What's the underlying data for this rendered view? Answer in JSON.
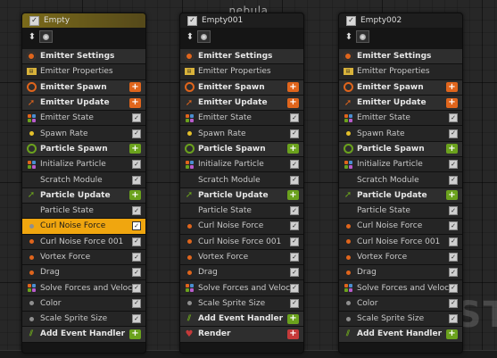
{
  "system": {
    "title": "nebula",
    "watermark": "SYSTE"
  },
  "colors": {
    "spawn": "#e0651c",
    "particle": "#6ba21d",
    "selection": "#f0a60f",
    "render": "#c53a3a"
  },
  "emitters": [
    {
      "name": "Empty",
      "selected": true,
      "rows": [
        {
          "label": "Emitter Settings",
          "kind": "section",
          "icon": "settings-icon"
        },
        {
          "label": "Emitter Properties",
          "kind": "module",
          "icon": "properties-icon"
        },
        {
          "label": "Emitter Spawn",
          "kind": "section",
          "icon": "spawn-ring-icon",
          "button": "+",
          "btn_color": "orange"
        },
        {
          "label": "Emitter Update",
          "kind": "section",
          "icon": "update-arrow-icon",
          "button": "+",
          "btn_color": "orange"
        },
        {
          "label": "Emitter State",
          "kind": "module",
          "icon": "multi-dot-icon",
          "check": "✓"
        },
        {
          "label": "Spawn Rate",
          "kind": "module",
          "icon": "dot-yellow-icon",
          "check": "✓"
        },
        {
          "label": "Particle Spawn",
          "kind": "section",
          "icon": "particle-ring-icon",
          "button": "+",
          "btn_color": "green"
        },
        {
          "label": "Initialize Particle",
          "kind": "module",
          "icon": "multi-dot-icon",
          "check": "✓"
        },
        {
          "label": "Scratch Module",
          "kind": "module",
          "icon": "none",
          "check": "✓"
        },
        {
          "label": "Particle Update",
          "kind": "section",
          "icon": "particle-arrow-icon",
          "button": "+",
          "btn_color": "green"
        },
        {
          "label": "Particle State",
          "kind": "module",
          "icon": "none",
          "check": "✓"
        },
        {
          "label": "Curl Noise Force",
          "kind": "highlight",
          "icon": "dot-gray-icon",
          "check": "✓"
        },
        {
          "label": "Curl Noise Force 001",
          "kind": "module",
          "icon": "dot-orange-icon",
          "check": "✓"
        },
        {
          "label": "Vortex Force",
          "kind": "module",
          "icon": "dot-orange-icon",
          "check": "✓"
        },
        {
          "label": "Drag",
          "kind": "module",
          "icon": "dot-orange-icon",
          "check": "✓"
        },
        {
          "label": "Solve Forces and Velocity",
          "kind": "module",
          "icon": "multi-dot-icon",
          "check": "✓"
        },
        {
          "label": "Color",
          "kind": "module",
          "icon": "dot-gray-icon",
          "check": "✓"
        },
        {
          "label": "Scale Sprite Size",
          "kind": "module",
          "icon": "dot-gray-icon",
          "check": "✓"
        },
        {
          "label": "Add Event Handler",
          "kind": "section",
          "icon": "event-handler-icon",
          "button": "+",
          "btn_color": "green"
        }
      ]
    },
    {
      "name": "Empty001",
      "selected": false,
      "rows": [
        {
          "label": "Emitter Settings",
          "kind": "section",
          "icon": "settings-icon"
        },
        {
          "label": "Emitter Properties",
          "kind": "module",
          "icon": "properties-icon"
        },
        {
          "label": "Emitter Spawn",
          "kind": "section",
          "icon": "spawn-ring-icon",
          "button": "+",
          "btn_color": "orange"
        },
        {
          "label": "Emitter Update",
          "kind": "section",
          "icon": "update-arrow-icon",
          "button": "+",
          "btn_color": "orange"
        },
        {
          "label": "Emitter State",
          "kind": "module",
          "icon": "multi-dot-icon",
          "check": "✓"
        },
        {
          "label": "Spawn Rate",
          "kind": "module",
          "icon": "dot-yellow-icon",
          "check": "✓"
        },
        {
          "label": "Particle Spawn",
          "kind": "section",
          "icon": "particle-ring-icon",
          "button": "+",
          "btn_color": "green"
        },
        {
          "label": "Initialize Particle",
          "kind": "module",
          "icon": "multi-dot-icon",
          "check": "✓"
        },
        {
          "label": "Scratch Module",
          "kind": "module",
          "icon": "none",
          "check": "✓"
        },
        {
          "label": "Particle Update",
          "kind": "section",
          "icon": "particle-arrow-icon",
          "button": "+",
          "btn_color": "green"
        },
        {
          "label": "Particle State",
          "kind": "module",
          "icon": "none",
          "check": "✓"
        },
        {
          "label": "Curl Noise Force",
          "kind": "module",
          "icon": "dot-orange-icon",
          "check": "✓"
        },
        {
          "label": "Curl Noise Force 001",
          "kind": "module",
          "icon": "dot-orange-icon",
          "check": "✓"
        },
        {
          "label": "Vortex Force",
          "kind": "module",
          "icon": "dot-orange-icon",
          "check": "✓"
        },
        {
          "label": "Drag",
          "kind": "module",
          "icon": "dot-orange-icon",
          "check": "✓"
        },
        {
          "label": "Solve Forces and Velocity",
          "kind": "module",
          "icon": "multi-dot-icon",
          "check": "✓"
        },
        {
          "label": "Scale Sprite Size",
          "kind": "module",
          "icon": "dot-gray-icon",
          "check": "✓"
        },
        {
          "label": "Add Event Handler",
          "kind": "section",
          "icon": "event-handler-icon",
          "button": "+",
          "btn_color": "green"
        },
        {
          "label": "Render",
          "kind": "section",
          "icon": "render-icon",
          "button": "+",
          "btn_color": "red"
        }
      ]
    },
    {
      "name": "Empty002",
      "selected": false,
      "rows": [
        {
          "label": "Emitter Settings",
          "kind": "section",
          "icon": "settings-icon"
        },
        {
          "label": "Emitter Properties",
          "kind": "module",
          "icon": "properties-icon"
        },
        {
          "label": "Emitter Spawn",
          "kind": "section",
          "icon": "spawn-ring-icon",
          "button": "+",
          "btn_color": "orange"
        },
        {
          "label": "Emitter Update",
          "kind": "section",
          "icon": "update-arrow-icon",
          "button": "+",
          "btn_color": "orange"
        },
        {
          "label": "Emitter State",
          "kind": "module",
          "icon": "multi-dot-icon",
          "check": "✓"
        },
        {
          "label": "Spawn Rate",
          "kind": "module",
          "icon": "dot-yellow-icon",
          "check": "✓"
        },
        {
          "label": "Particle Spawn",
          "kind": "section",
          "icon": "particle-ring-icon",
          "button": "+",
          "btn_color": "green"
        },
        {
          "label": "Initialize Particle",
          "kind": "module",
          "icon": "multi-dot-icon",
          "check": "✓"
        },
        {
          "label": "Scratch Module",
          "kind": "module",
          "icon": "none",
          "check": "✓"
        },
        {
          "label": "Particle Update",
          "kind": "section",
          "icon": "particle-arrow-icon",
          "button": "+",
          "btn_color": "green"
        },
        {
          "label": "Particle State",
          "kind": "module",
          "icon": "none",
          "check": "✓"
        },
        {
          "label": "Curl Noise Force",
          "kind": "module",
          "icon": "dot-orange-icon",
          "check": "✓"
        },
        {
          "label": "Curl Noise Force 001",
          "kind": "module",
          "icon": "dot-orange-icon",
          "check": "✓"
        },
        {
          "label": "Vortex Force",
          "kind": "module",
          "icon": "dot-orange-icon",
          "check": "✓"
        },
        {
          "label": "Drag",
          "kind": "module",
          "icon": "dot-orange-icon",
          "check": "✓"
        },
        {
          "label": "Solve Forces and Velocity",
          "kind": "module",
          "icon": "multi-dot-icon",
          "check": "✓"
        },
        {
          "label": "Color",
          "kind": "module",
          "icon": "dot-gray-icon",
          "check": "✓"
        },
        {
          "label": "Scale Sprite Size",
          "kind": "module",
          "icon": "dot-gray-icon",
          "check": "✓"
        },
        {
          "label": "Add Event Handler",
          "kind": "section",
          "icon": "event-handler-icon",
          "button": "+",
          "btn_color": "green"
        }
      ]
    }
  ]
}
